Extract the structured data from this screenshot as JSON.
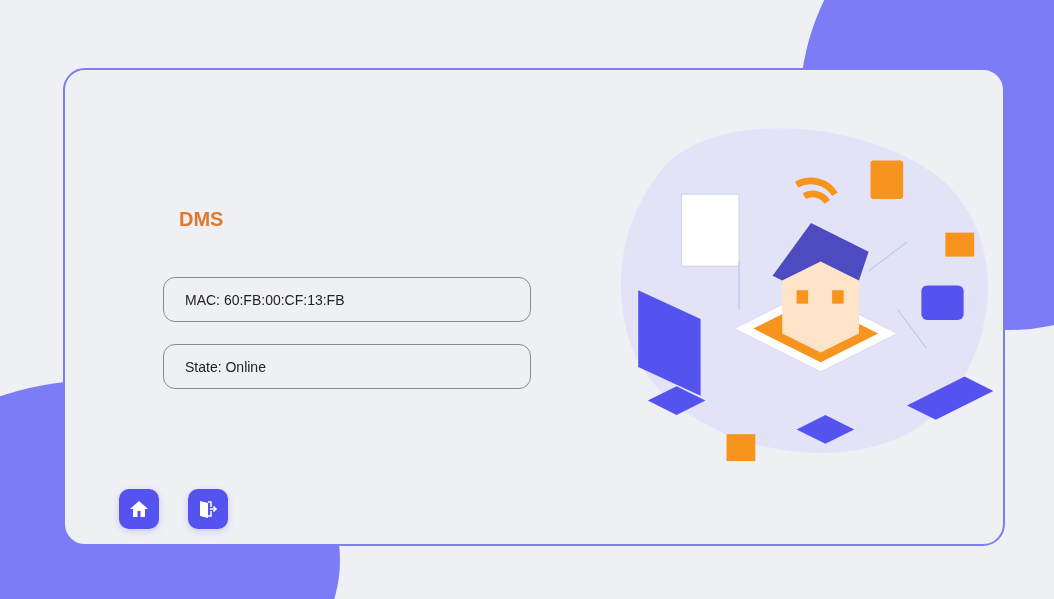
{
  "app": {
    "title": "DMS"
  },
  "fields": [
    {
      "text": "MAC: 60:FB:00:CF:13:FB"
    },
    {
      "text": "State: Online"
    }
  ]
}
